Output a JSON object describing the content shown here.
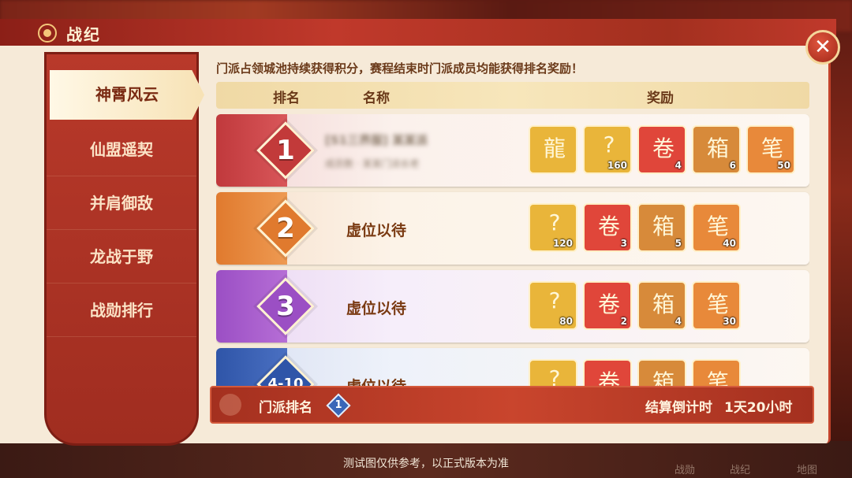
{
  "window": {
    "title": "战纪",
    "close_glyph": "✕"
  },
  "sidebar": {
    "items": [
      {
        "label": "神霄风云",
        "active": true
      },
      {
        "label": "仙盟遥契",
        "active": false
      },
      {
        "label": "并肩御敌",
        "active": false
      },
      {
        "label": "龙战于野",
        "active": false
      },
      {
        "label": "战勋排行",
        "active": false
      }
    ]
  },
  "main": {
    "notice": "门派占领城池持续获得积分，赛程结束时门派成员均能获得排名奖励！",
    "columns": {
      "rank": "排名",
      "name": "名称",
      "reward": "奖励"
    },
    "rows": [
      {
        "rank": "1",
        "name": "[S1三界服] 某某派",
        "sub": "成员数 · 某某门派长老",
        "rewards": [
          {
            "icon": "golden-dragon-staff-icon",
            "count": ""
          },
          {
            "icon": "mystery-gold-ingot-icon",
            "count": "160"
          },
          {
            "icon": "red-dragon-scroll-icon",
            "count": "4"
          },
          {
            "icon": "treasure-chest-icon",
            "count": "6"
          },
          {
            "icon": "golden-brush-icon",
            "count": "50"
          }
        ]
      },
      {
        "rank": "2",
        "name": "虚位以待",
        "rewards": [
          {
            "icon": "mystery-gold-ingot-icon",
            "count": "120"
          },
          {
            "icon": "red-dragon-scroll-icon",
            "count": "3"
          },
          {
            "icon": "treasure-chest-icon",
            "count": "5"
          },
          {
            "icon": "golden-brush-icon",
            "count": "40"
          }
        ]
      },
      {
        "rank": "3",
        "name": "虚位以待",
        "rewards": [
          {
            "icon": "mystery-gold-ingot-icon",
            "count": "80"
          },
          {
            "icon": "red-dragon-scroll-icon",
            "count": "2"
          },
          {
            "icon": "treasure-chest-icon",
            "count": "4"
          },
          {
            "icon": "golden-brush-icon",
            "count": "30"
          }
        ]
      },
      {
        "rank": "4-10",
        "name": "虚位以待",
        "rewards": [
          {
            "icon": "mystery-gold-ingot-icon",
            "count": ""
          },
          {
            "icon": "red-dragon-scroll-icon",
            "count": ""
          },
          {
            "icon": "treasure-chest-icon",
            "count": ""
          },
          {
            "icon": "golden-brush-icon",
            "count": ""
          }
        ]
      }
    ]
  },
  "footer": {
    "sect_rank_label": "门派排名",
    "sect_rank_value": "1",
    "countdown_label": "结算倒计时",
    "countdown_value": "1天20小时"
  },
  "disclaimer": "测试图仅供参考，以正式版本为准",
  "hud": {
    "left": "战勋",
    "middle": "战纪",
    "right": "地图"
  },
  "colors": {
    "rank1": "#c23a3a",
    "rank2": "#e07a2e",
    "rank3": "#9b4fc4",
    "rank4": "#2f55a8",
    "reward_gold": "#e9b53a",
    "reward_red": "#e0463a",
    "reward_orange": "#e8893a"
  }
}
